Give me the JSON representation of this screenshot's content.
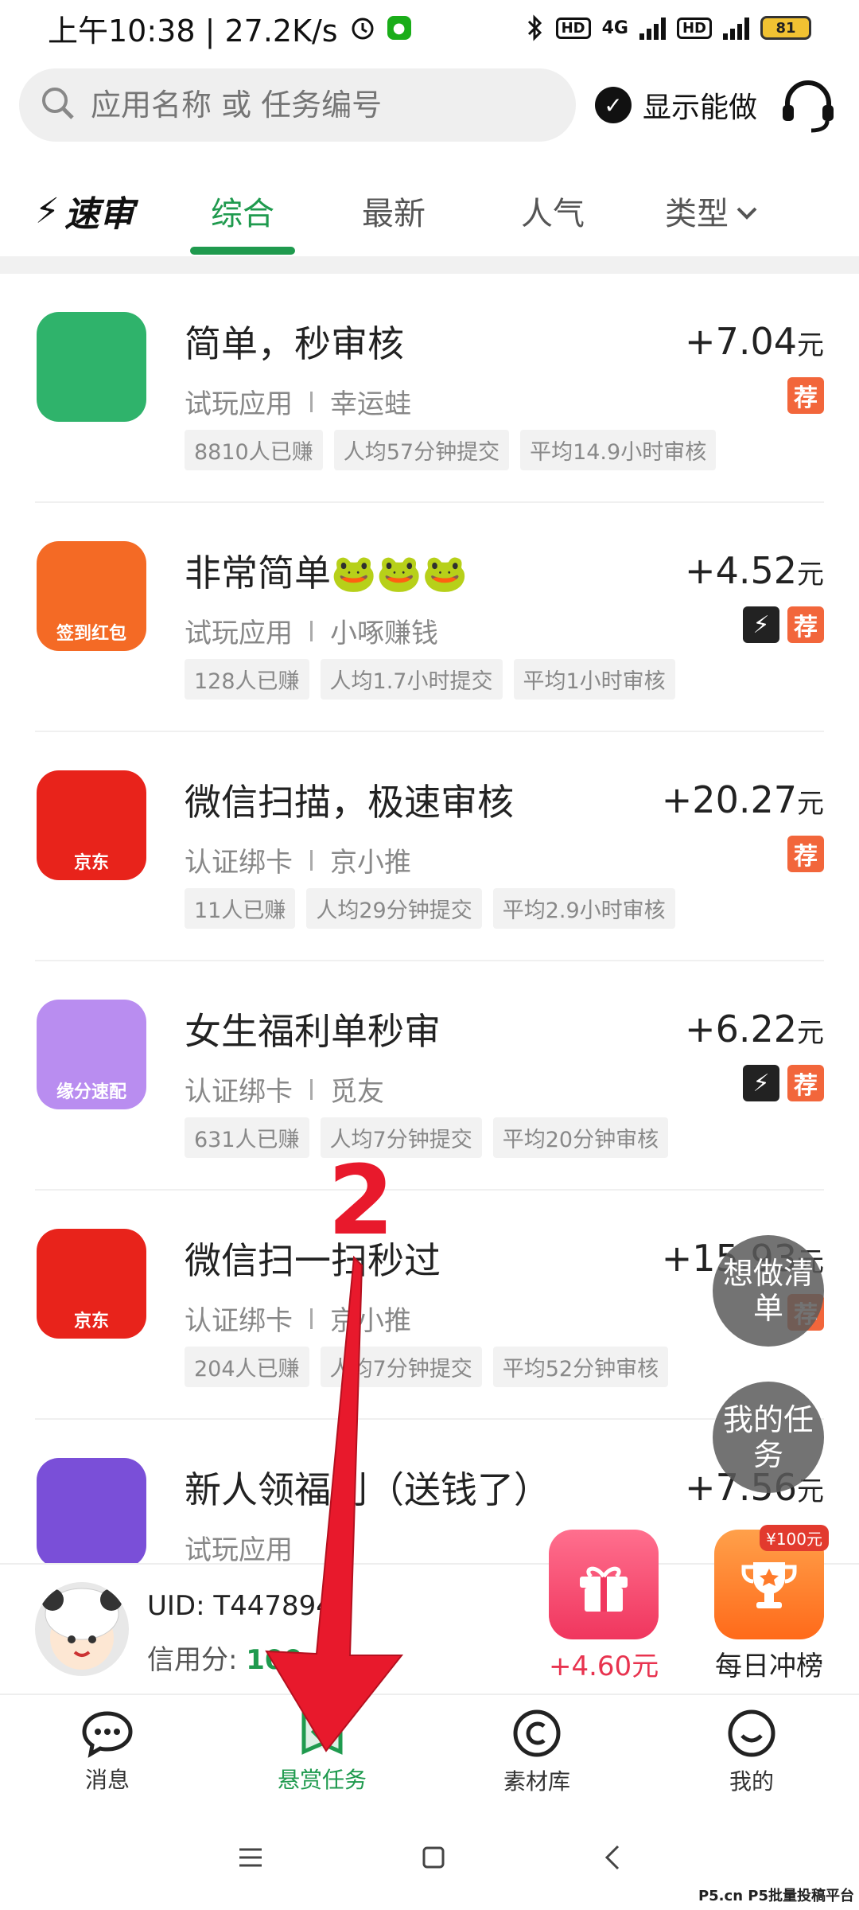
{
  "status_bar": {
    "time": "上午10:38 | 27.2K/s",
    "network": "4G",
    "battery": "81"
  },
  "search": {
    "placeholder": "应用名称 或 任务编号",
    "show_can_do": "显示能做"
  },
  "tabs": {
    "logo": "速审",
    "items": [
      "综合",
      "最新",
      "人气",
      "类型"
    ],
    "active": "综合"
  },
  "tasks": [
    {
      "title": "简单，秒审核",
      "price": "+7.04",
      "unit": "元",
      "category": "试玩应用",
      "app": "幸运蛙",
      "stats": [
        "8810人已赚",
        "人均57分钟提交",
        "平均14.9小时审核"
      ],
      "badges": [
        "荐"
      ],
      "app_color": "#2fb36b",
      "app_caption": ""
    },
    {
      "title": "非常简单🐸🐸🐸",
      "price": "+4.52",
      "unit": "元",
      "category": "试玩应用",
      "app": "小啄赚钱",
      "stats": [
        "128人已赚",
        "人均1.7小时提交",
        "平均1小时审核"
      ],
      "badges": [
        "⚡",
        "荐"
      ],
      "app_color": "#f46a25",
      "app_caption": "签到红包"
    },
    {
      "title": "微信扫描，极速审核",
      "price": "+20.27",
      "unit": "元",
      "category": "认证绑卡",
      "app": "京小推",
      "stats": [
        "11人已赚",
        "人均29分钟提交",
        "平均2.9小时审核"
      ],
      "badges": [
        "荐"
      ],
      "app_color": "#e8231b",
      "app_caption": "京东"
    },
    {
      "title": "女生福利单秒审",
      "price": "+6.22",
      "unit": "元",
      "category": "认证绑卡",
      "app": "觅友",
      "stats": [
        "631人已赚",
        "人均7分钟提交",
        "平均20分钟审核"
      ],
      "badges": [
        "⚡",
        "荐"
      ],
      "app_color": "#b98df0",
      "app_caption": "缘分速配"
    },
    {
      "title": "微信扫一扫秒过",
      "price": "+15.93",
      "unit": "元",
      "category": "认证绑卡",
      "app": "京小推",
      "stats": [
        "204人已赚",
        "人均7分钟提交",
        "平均52分钟审核"
      ],
      "badges": [
        "荐"
      ],
      "app_color": "#e8231b",
      "app_caption": "京东"
    },
    {
      "title": "新人领福利（送钱了）",
      "price": "+7.56",
      "unit": "元",
      "category": "试玩应用",
      "app": "",
      "stats": [],
      "badges": [],
      "app_color": "#7a4fd8",
      "app_caption": ""
    }
  ],
  "floating": {
    "wish": "想做清单",
    "my_tasks": "我的任务"
  },
  "user": {
    "uid": "UID: T447894",
    "credit_label": "信用分:",
    "credit_value": "100",
    "gift_amount": "+4.60元",
    "rank_label": "每日冲榜",
    "rank_tag": "¥100元"
  },
  "bottom_nav": [
    {
      "label": "消息",
      "icon": "message-icon"
    },
    {
      "label": "悬赏任务",
      "icon": "task-icon"
    },
    {
      "label": "素材库",
      "icon": "material-icon"
    },
    {
      "label": "我的",
      "icon": "profile-icon"
    }
  ],
  "annotation": {
    "number": "2"
  },
  "watermark": "P5.cn P5批量投稿平台",
  "colors": {
    "accent": "#1f9a4e",
    "badge": "#f2663b",
    "annotation": "#e8192c"
  }
}
